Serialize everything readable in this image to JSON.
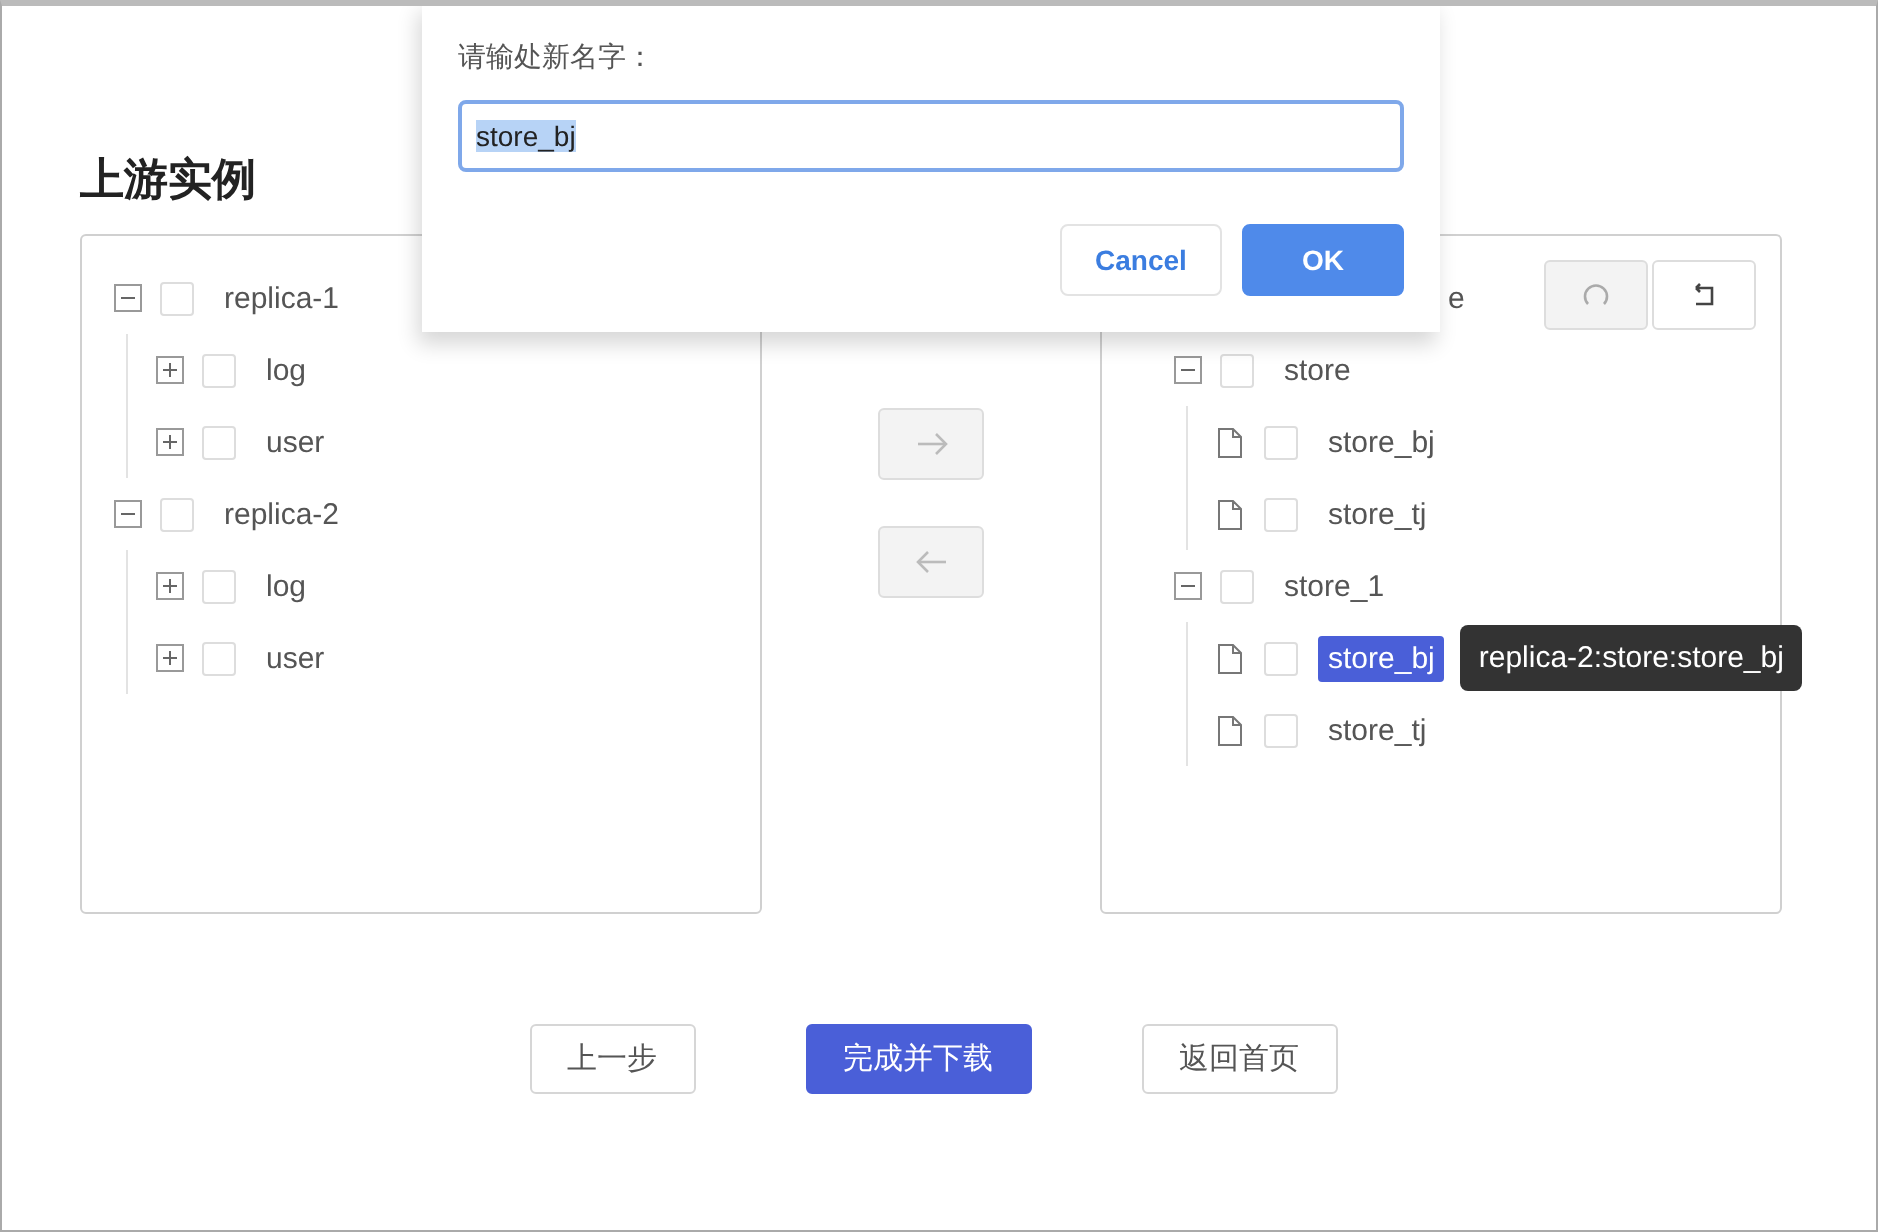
{
  "title": "上游实例",
  "source_tree": [
    {
      "label": "replica-1",
      "expanded": true,
      "checked": false,
      "children": [
        {
          "label": "log",
          "expanded": false,
          "checked": false
        },
        {
          "label": "user",
          "expanded": false,
          "checked": false
        }
      ]
    },
    {
      "label": "replica-2",
      "expanded": true,
      "checked": false,
      "children": [
        {
          "label": "log",
          "expanded": false,
          "checked": false
        },
        {
          "label": "user",
          "expanded": false,
          "checked": false
        }
      ]
    }
  ],
  "transfer_buttons": [
    {
      "kind": "right",
      "disabled": true
    },
    {
      "kind": "left",
      "disabled": true
    }
  ],
  "target_tree": {
    "root_label": "e",
    "tools": [
      {
        "kind": "refresh",
        "disabled": true
      },
      {
        "kind": "undo",
        "disabled": false
      }
    ],
    "items": [
      {
        "label": "store",
        "expanded": true,
        "checked": false,
        "children": [
          {
            "label": "store_bj",
            "checked": false,
            "selected": false
          },
          {
            "label": "store_tj",
            "checked": false,
            "selected": false
          }
        ]
      },
      {
        "label": "store_1",
        "expanded": true,
        "checked": false,
        "children": [
          {
            "label": "store_bj",
            "checked": false,
            "selected": true,
            "tooltip": "replica-2:store:store_bj"
          },
          {
            "label": "store_tj",
            "checked": false,
            "selected": false
          }
        ]
      }
    ]
  },
  "footer_buttons": [
    {
      "label": "上一步",
      "kind": "default"
    },
    {
      "label": "完成并下载",
      "kind": "primary"
    },
    {
      "label": "返回首页",
      "kind": "default"
    }
  ],
  "dialog": {
    "prompt": "请输处新名字：",
    "value": "store_bj",
    "buttons": [
      {
        "label": "Cancel",
        "kind": "secondary"
      },
      {
        "label": "OK",
        "kind": "primary"
      }
    ]
  }
}
